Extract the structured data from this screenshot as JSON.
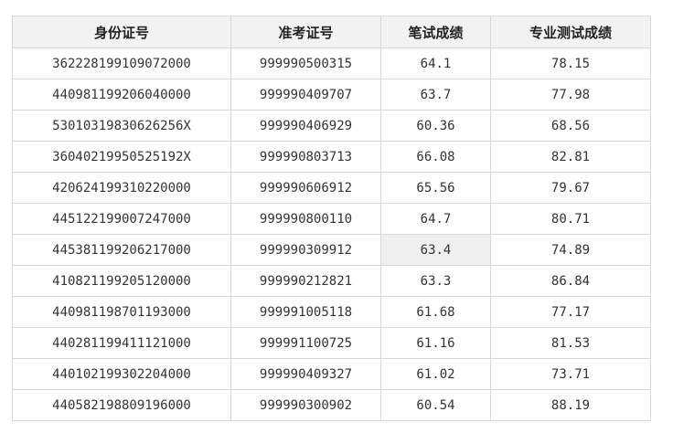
{
  "table": {
    "headers": [
      "身份证号",
      "准考证号",
      "笔试成绩",
      "专业测试成绩"
    ],
    "rows": [
      [
        "362228199109072000",
        "999990500315",
        "64.1",
        "78.15"
      ],
      [
        "440981199206040000",
        "999990409707",
        "63.7",
        "77.98"
      ],
      [
        "53010319830626256X",
        "999990406929",
        "60.36",
        "68.56"
      ],
      [
        "36040219950525192X",
        "999990803713",
        "66.08",
        "82.81"
      ],
      [
        "420624199310220000",
        "999990606912",
        "65.56",
        "79.67"
      ],
      [
        "445122199007247000",
        "999990800110",
        "64.7",
        "80.71"
      ],
      [
        "445381199206217000",
        "999990309912",
        "63.4",
        "74.89"
      ],
      [
        "410821199205120000",
        "999990212821",
        "63.3",
        "86.84"
      ],
      [
        "440981198701193000",
        "999991005118",
        "61.68",
        "77.17"
      ],
      [
        "440281199411121000",
        "999991100725",
        "61.16",
        "81.53"
      ],
      [
        "440102199302204000",
        "999990409327",
        "61.02",
        "73.71"
      ],
      [
        "440582198809196000",
        "999990300902",
        "60.54",
        "88.19"
      ]
    ]
  },
  "colors": {
    "header_bg": "#f2f2f2",
    "border": "#d8d8d8",
    "hover_cell_bg": "#efefef",
    "text": "#333333"
  }
}
